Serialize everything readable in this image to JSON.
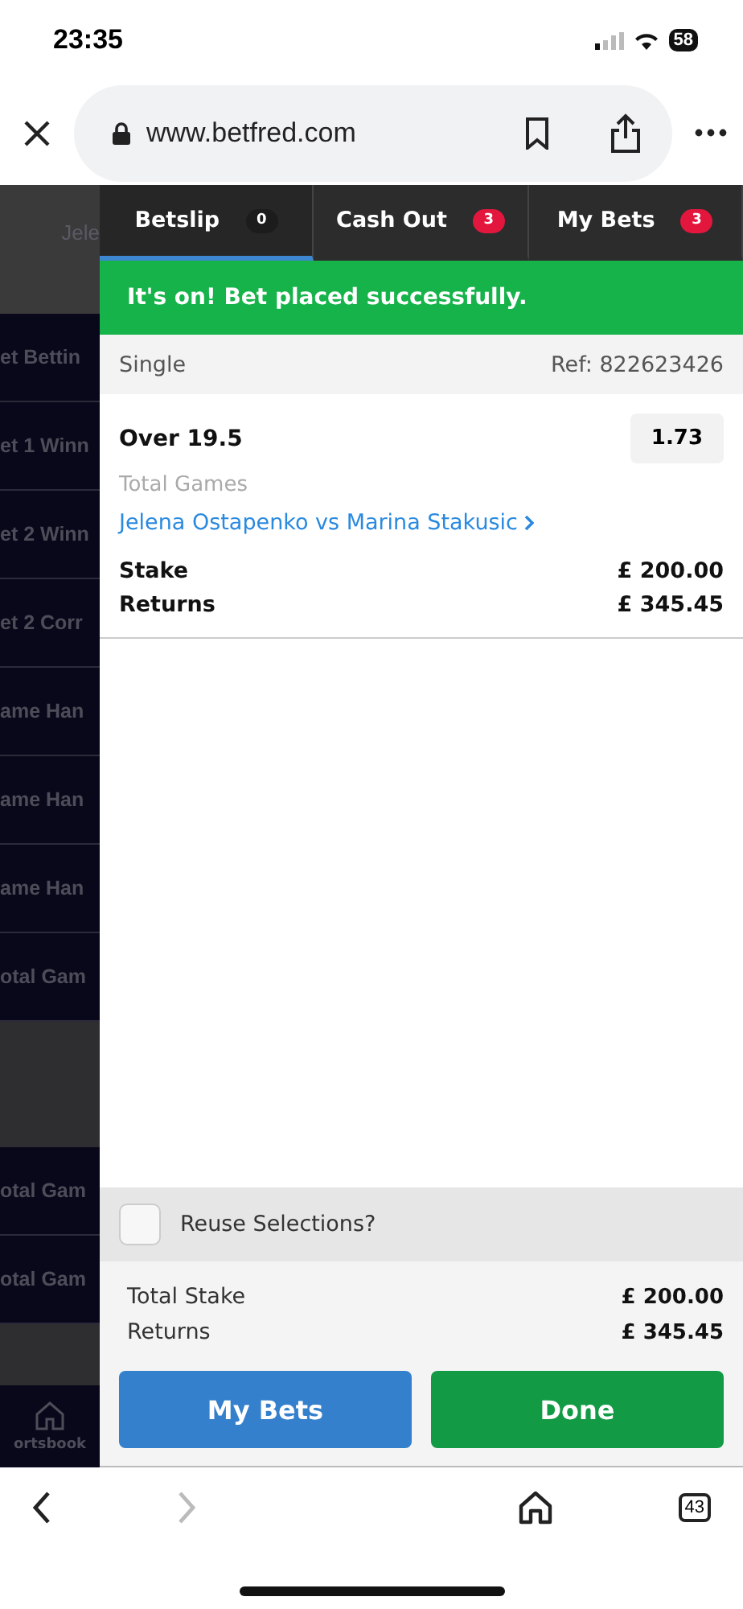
{
  "status_bar": {
    "time": "23:35",
    "battery": "58"
  },
  "browser": {
    "url": "www.betfred.com",
    "tab_count": "43",
    "nav_buttons": [
      {
        "kind": "back",
        "disabled": false
      },
      {
        "kind": "forward",
        "disabled": true
      }
    ]
  },
  "background": {
    "header_text": "Jele",
    "market_groups": [
      {
        "markets": [
          "et Bettin",
          "et 1 Winn",
          "et 2 Winn",
          "et 2 Corr",
          "ame Han",
          "ame Han",
          "ame Han",
          "otal Gam"
        ]
      },
      {
        "markets": [
          "otal Gam",
          "otal Gam"
        ]
      }
    ],
    "nav_label": "ortsbook"
  },
  "tabs": [
    {
      "label": "Betslip",
      "count": "0",
      "color": "#1c1c1c",
      "selected": true
    },
    {
      "label": "Cash Out",
      "count": "3",
      "color": "#e3173e",
      "selected": false
    },
    {
      "label": "My Bets",
      "count": "3",
      "color": "#e3173e",
      "selected": false
    }
  ],
  "banner": "It's on! Bet placed successfully.",
  "bet": {
    "type": "Single",
    "ref": "Ref: 822623426",
    "selection": "Over 19.5",
    "odds": "1.73",
    "market": "Total Games",
    "event": "Jelena Ostapenko vs Marina Stakusic",
    "stake_label": "Stake",
    "stake": "£ 200.00",
    "returns_label": "Returns",
    "returns": "£ 345.45"
  },
  "reuse": {
    "label": "Reuse Selections?",
    "checked": false
  },
  "totals": [
    {
      "label": "Total Stake",
      "value": "£ 200.00"
    },
    {
      "label": "Returns",
      "value": "£ 345.45"
    }
  ],
  "buttons": [
    {
      "label": "My Bets",
      "kind": "secondary"
    },
    {
      "label": "Done",
      "kind": "primary"
    }
  ]
}
